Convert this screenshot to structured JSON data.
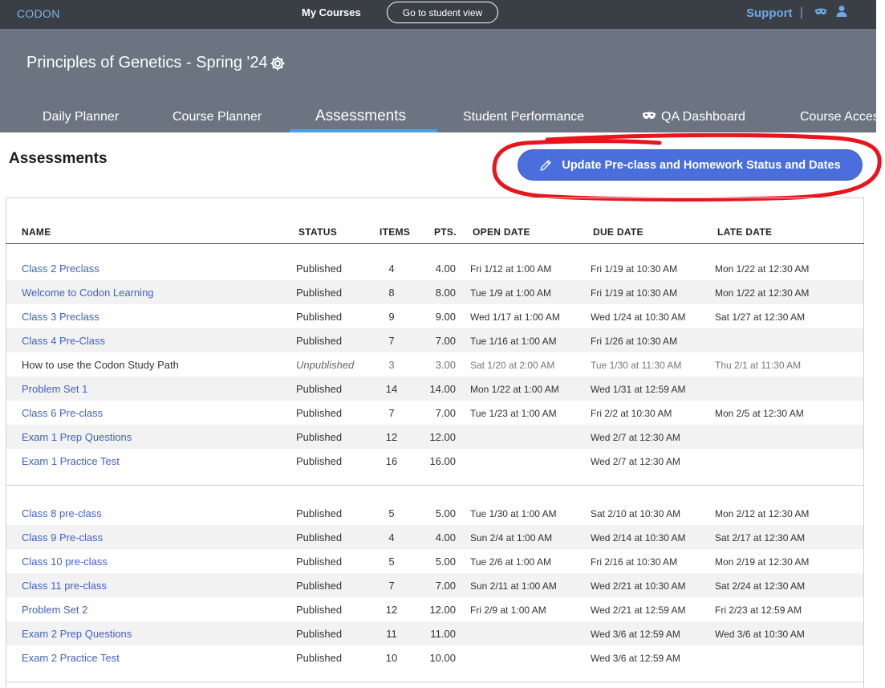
{
  "topbar": {
    "brand": "CODON",
    "my_courses": "My Courses",
    "student_view": "Go to student view",
    "support": "Support",
    "separator": "|",
    "icons": [
      "mask-icon",
      "user-icon"
    ]
  },
  "course": {
    "title": "Principles of Genetics - Spring '24",
    "icon": "gear-icon"
  },
  "tabs": [
    {
      "label": "Daily Planner"
    },
    {
      "label": "Course Planner"
    },
    {
      "label": "Assessments",
      "active": true
    },
    {
      "label": "Student Performance"
    },
    {
      "label": "QA Dashboard",
      "icon": "mask-icon"
    },
    {
      "label": "Course Access"
    }
  ],
  "page": {
    "title": "Assessments",
    "update_button": "Update Pre-class and Homework Status and Dates"
  },
  "colors": {
    "topbar": "#3a3f46",
    "header": "#6b7480",
    "accent": "#4a6fdc",
    "link": "#3f62c5",
    "highlight": "#e8141e"
  },
  "table": {
    "headers": [
      "NAME",
      "STATUS",
      "ITEMS",
      "PTS.",
      "OPEN DATE",
      "DUE DATE",
      "LATE DATE"
    ],
    "groups": [
      [
        {
          "name": "Class 2 Preclass",
          "status": "Published",
          "items": "4",
          "pts": "4.00",
          "open": "Fri 1/12 at 1:00 AM",
          "due": "Fri 1/19 at 10:30 AM",
          "late": "Mon 1/22 at 12:30 AM"
        },
        {
          "name": "Welcome to Codon Learning",
          "status": "Published",
          "items": "8",
          "pts": "8.00",
          "open": "Tue 1/9 at 1:00 AM",
          "due": "Fri 1/19 at 10:30 AM",
          "late": "Mon 1/22 at 12:30 AM"
        },
        {
          "name": "Class 3 Preclass",
          "status": "Published",
          "items": "9",
          "pts": "9.00",
          "open": "Wed 1/17 at 1:00 AM",
          "due": "Wed 1/24 at 10:30 AM",
          "late": "Sat 1/27 at 12:30 AM"
        },
        {
          "name": "Class 4 Pre-Class",
          "status": "Published",
          "items": "7",
          "pts": "7.00",
          "open": "Tue 1/16 at 1:00 AM",
          "due": "Fri 1/26 at 10:30 AM",
          "late": ""
        },
        {
          "name": "How to use the Codon Study Path",
          "status": "Unpublished",
          "items": "3",
          "pts": "3.00",
          "open": "Sat 1/20 at 2:00 AM",
          "due": "Tue 1/30 at 11:30 AM",
          "late": "Thu 2/1 at 11:30 AM"
        },
        {
          "name": "Problem Set 1",
          "status": "Published",
          "items": "14",
          "pts": "14.00",
          "open": "Mon 1/22 at 1:00 AM",
          "due": "Wed 1/31 at 12:59 AM",
          "late": ""
        },
        {
          "name": "Class 6 Pre-class",
          "status": "Published",
          "items": "7",
          "pts": "7.00",
          "open": "Tue 1/23 at 1:00 AM",
          "due": "Fri 2/2 at 10:30 AM",
          "late": "Mon 2/5 at 12:30 AM"
        },
        {
          "name": "Exam 1 Prep Questions",
          "status": "Published",
          "items": "12",
          "pts": "12.00",
          "open": "",
          "due": "Wed 2/7 at 12:30 AM",
          "late": ""
        },
        {
          "name": "Exam 1 Practice Test",
          "status": "Published",
          "items": "16",
          "pts": "16.00",
          "open": "",
          "due": "Wed 2/7 at 12:30 AM",
          "late": ""
        }
      ],
      [
        {
          "name": "Class 8 pre-class",
          "status": "Published",
          "items": "5",
          "pts": "5.00",
          "open": "Tue 1/30 at 1:00 AM",
          "due": "Sat 2/10 at 10:30 AM",
          "late": "Mon 2/12 at 12:30 AM"
        },
        {
          "name": "Class 9 Pre-class",
          "status": "Published",
          "items": "4",
          "pts": "4.00",
          "open": "Sun 2/4 at 1:00 AM",
          "due": "Wed 2/14 at 10:30 AM",
          "late": "Sat 2/17 at 12:30 AM"
        },
        {
          "name": "Class 10 pre-class",
          "status": "Published",
          "items": "5",
          "pts": "5.00",
          "open": "Tue 2/6 at 1:00 AM",
          "due": "Fri 2/16 at 10:30 AM",
          "late": "Mon 2/19 at 12:30 AM"
        },
        {
          "name": "Class 11 pre-class",
          "status": "Published",
          "items": "7",
          "pts": "7.00",
          "open": "Sun 2/11 at 1:00 AM",
          "due": "Wed 2/21 at 10:30 AM",
          "late": "Sat 2/24 at 12:30 AM"
        },
        {
          "name": "Problem Set 2",
          "status": "Published",
          "items": "12",
          "pts": "12.00",
          "open": "Fri 2/9 at 1:00 AM",
          "due": "Wed 2/21 at 12:59 AM",
          "late": "Fri 2/23 at 12:59 AM"
        },
        {
          "name": "Exam 2 Prep Questions",
          "status": "Published",
          "items": "11",
          "pts": "11.00",
          "open": "",
          "due": "Wed 3/6 at 12:59 AM",
          "late": "Wed 3/6 at 10:30 AM"
        },
        {
          "name": "Exam 2 Practice Test",
          "status": "Published",
          "items": "10",
          "pts": "10.00",
          "open": "",
          "due": "Wed 3/6 at 12:59 AM",
          "late": ""
        }
      ]
    ]
  }
}
